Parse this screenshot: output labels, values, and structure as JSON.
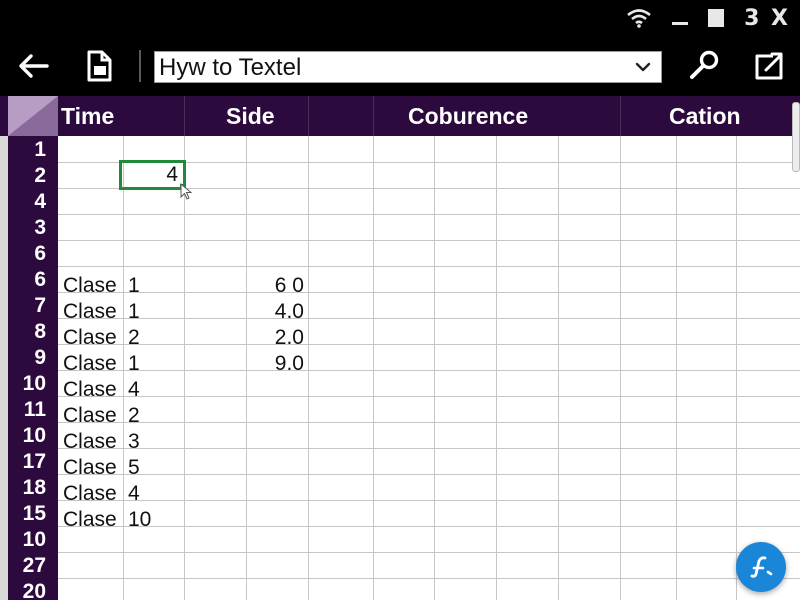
{
  "status_bar": {
    "text": "3 X"
  },
  "toolbar": {
    "search_value": "Hyw to Textel"
  },
  "sheet": {
    "column_headers": [
      "Time",
      "Side",
      "Coburence",
      "Cation"
    ],
    "row_numbers": [
      "1",
      "2",
      "4",
      "3",
      "6",
      "6",
      "7",
      "8",
      "9",
      "10",
      "11",
      "10",
      "17",
      "18",
      "15",
      "10",
      "27",
      "20"
    ],
    "active_cell_value": "4",
    "rows": [
      {
        "row": "6",
        "col_a": "Clase",
        "col_b": "1",
        "col_d": "6 0"
      },
      {
        "row": "7",
        "col_a": "Clase",
        "col_b": "1",
        "col_d": "4.0"
      },
      {
        "row": "8",
        "col_a": "Clase",
        "col_b": "2",
        "col_d": "2.0"
      },
      {
        "row": "9",
        "col_a": "Clase",
        "col_b": "1",
        "col_d": "9.0"
      },
      {
        "row": "10",
        "col_a": "Clase",
        "col_b": "4",
        "col_d": ""
      },
      {
        "row": "11",
        "col_a": "Clase",
        "col_b": "2",
        "col_d": ""
      },
      {
        "row": "10",
        "col_a": "Clase",
        "col_b": "3",
        "col_d": ""
      },
      {
        "row": "17",
        "col_a": "Clase",
        "col_b": "5",
        "col_d": ""
      },
      {
        "row": "18",
        "col_a": "Clase",
        "col_b": "4",
        "col_d": ""
      },
      {
        "row": "15",
        "col_a": "Clase",
        "col_b": "10",
        "col_d": ""
      }
    ]
  },
  "icons": {
    "wifi": "wifi-icon",
    "minimize": "minimize-icon",
    "maximize": "maximize-icon",
    "back": "back-arrow-icon",
    "document": "document-icon",
    "dropdown": "chevron-down-icon",
    "search": "magnifier-icon",
    "share": "share-icon",
    "fab": "edit-icon"
  },
  "colors": {
    "header_purple": "#2d0a3e",
    "active_cell_border": "#1e8a3a",
    "fab_blue": "#1a86d8"
  }
}
